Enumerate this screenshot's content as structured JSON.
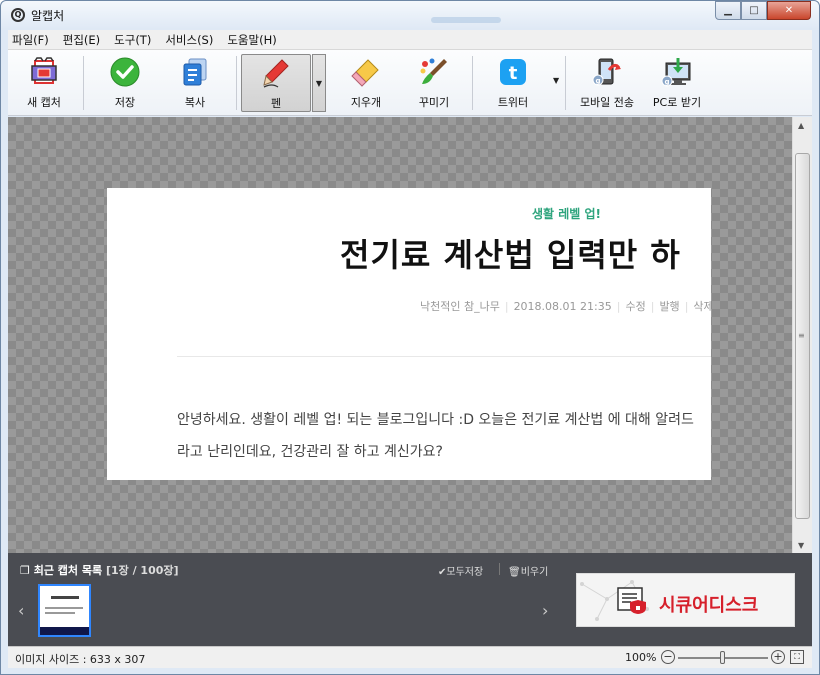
{
  "window": {
    "title": "알캡처"
  },
  "menu": [
    "파일(F)",
    "편집(E)",
    "도구(T)",
    "서비스(S)",
    "도움말(H)"
  ],
  "toolbar": {
    "new_capture": "새 캡처",
    "save": "저장",
    "copy": "복사",
    "pen": "펜",
    "eraser": "지우개",
    "decorate": "꾸미기",
    "twitter": "트위터",
    "mobile_send": "모바일 전송",
    "pc_receive": "PC로 받기"
  },
  "capture": {
    "category": "생활 레벨 업!",
    "title": "전기료 계산법 입력만 하",
    "meta": [
      "낙천적인 참_나무",
      "2018.08.01 21:35",
      "수정",
      "발행",
      "삭제"
    ],
    "body_line1": "안녕하세요. 생활이 레벨 업! 되는 블로그입니다 :D 오늘은 전기료 계산법 에 대해 알려드",
    "body_line2": "라고 난리인데요, 건강관리 잘 하고 계신가요?"
  },
  "recent": {
    "title": "최근 캡처 목록",
    "count": "[1장 / 100장]",
    "save_all": "모두저장",
    "clear_all": "비우기"
  },
  "ad": {
    "text": "시큐어디스크"
  },
  "status": {
    "image_size": "이미지 사이즈 : 633 x 307",
    "zoom": "100%",
    "zoom_level": 1.0
  }
}
